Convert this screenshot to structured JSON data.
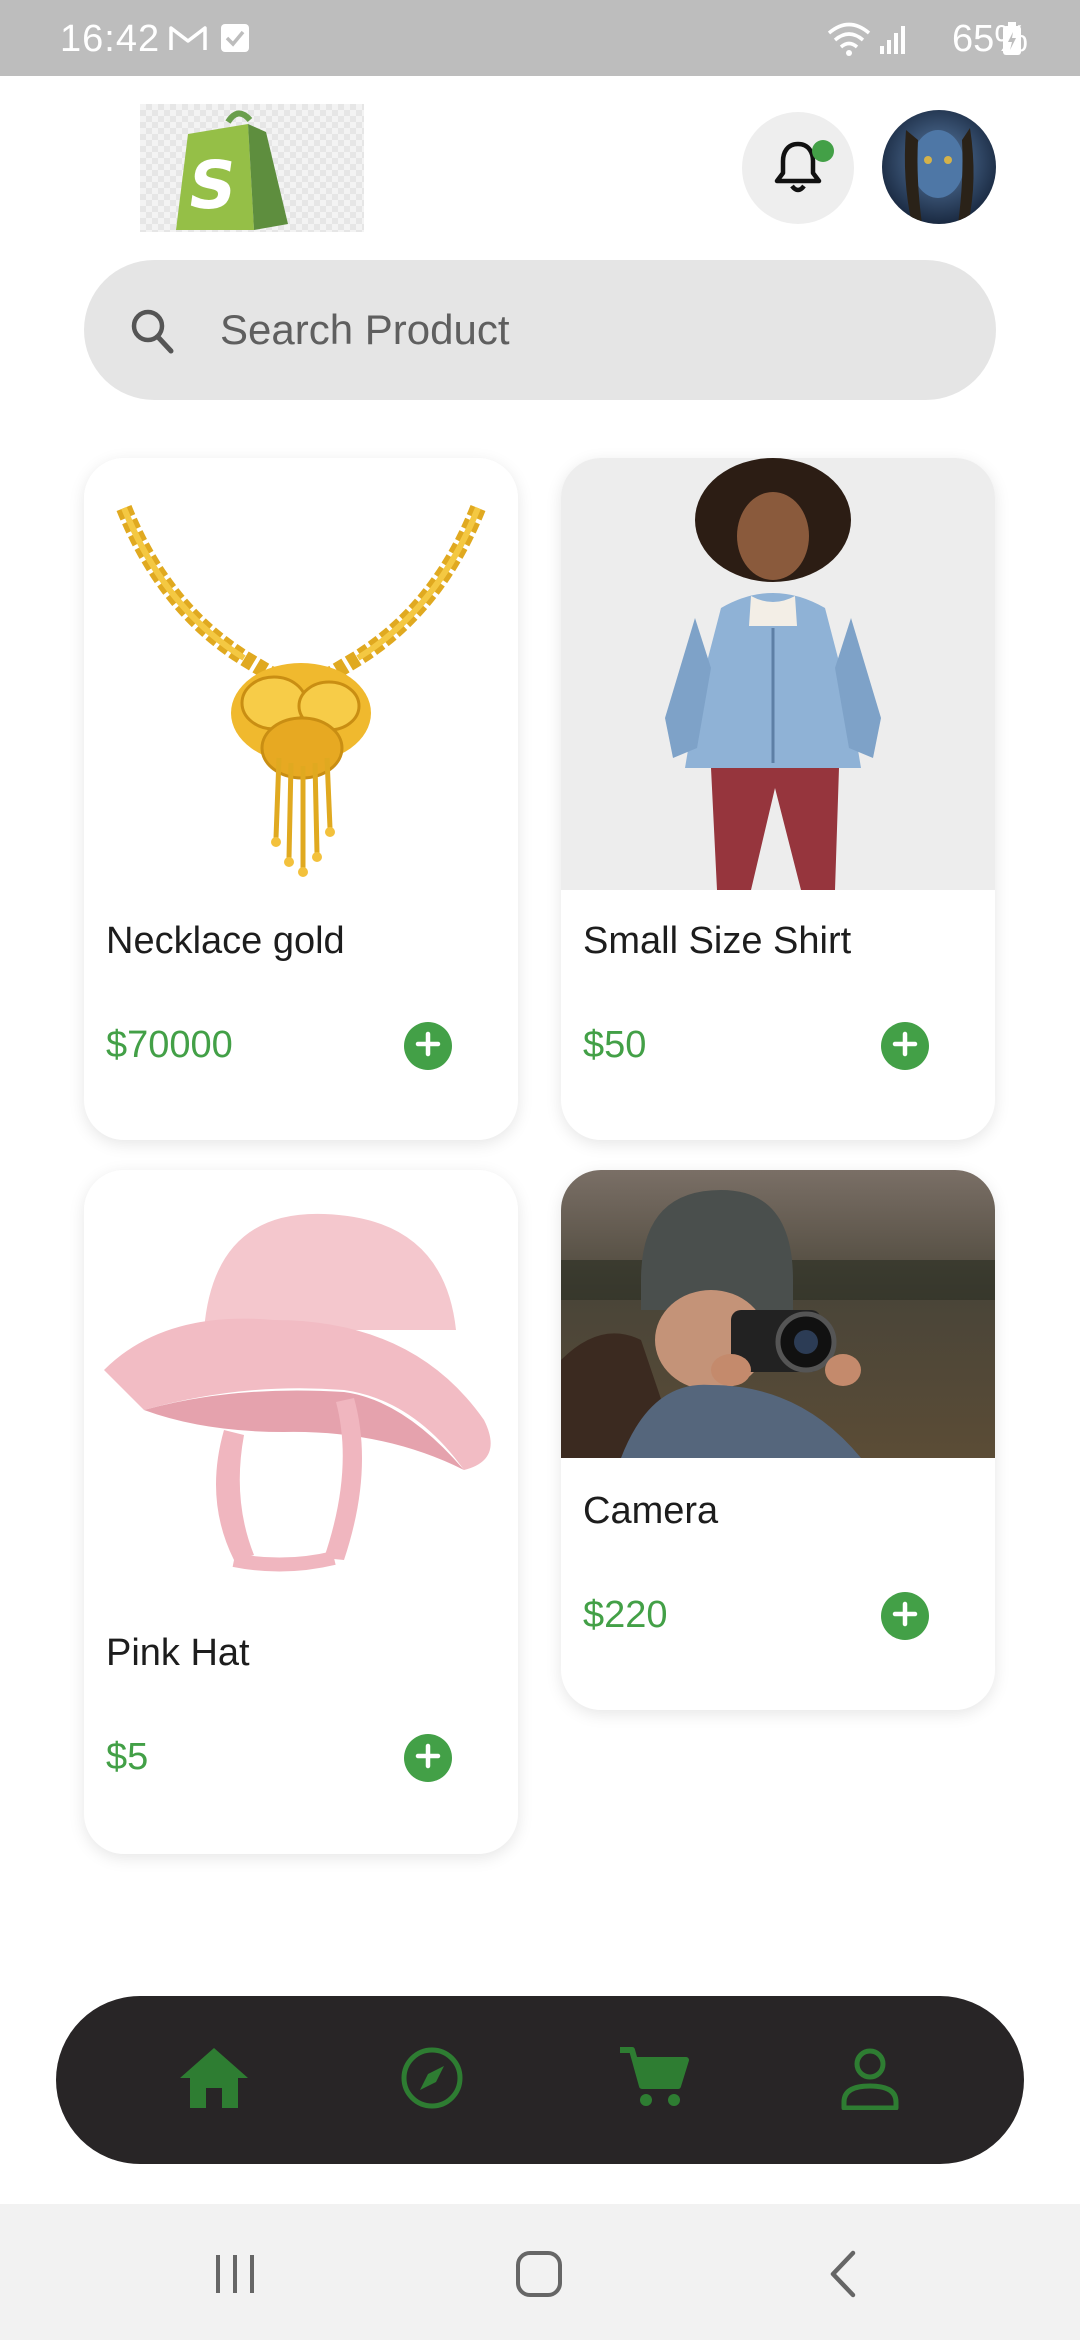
{
  "status_bar": {
    "time": "16:42",
    "battery": "65%",
    "left_icons": [
      "gmail-icon",
      "checkbox-icon"
    ],
    "right_icons": [
      "wifi-icon",
      "signal-icon",
      "battery-icon"
    ]
  },
  "header": {
    "logo": "shopify-bag-logo",
    "notification_dot": true,
    "avatar": "user-avatar"
  },
  "search": {
    "placeholder": "Search Product",
    "value": ""
  },
  "products": [
    {
      "name": "Necklace gold",
      "price": "$70000",
      "image": "gold-necklace"
    },
    {
      "name": "Small Size Shirt",
      "price": "$50",
      "image": "girl-denim-jacket"
    },
    {
      "name": "Pink Hat",
      "price": "$5",
      "image": "pink-bucket-hat"
    },
    {
      "name": "Camera",
      "price": "$220",
      "image": "person-with-camera"
    }
  ],
  "bottom_nav": {
    "items": [
      "home-icon",
      "compass-icon",
      "cart-icon",
      "profile-icon"
    ],
    "active": "home-icon"
  },
  "system_nav": [
    "recents-icon",
    "home-circle-icon",
    "back-icon"
  ],
  "colors": {
    "accent_green": "#43a047",
    "nav_icon_green": "#2e7d32",
    "nav_bg": "#282526",
    "search_bg": "#e5e5e5",
    "status_bar_bg": "#bdbdbd",
    "shopify_green": "#7ab55c"
  }
}
